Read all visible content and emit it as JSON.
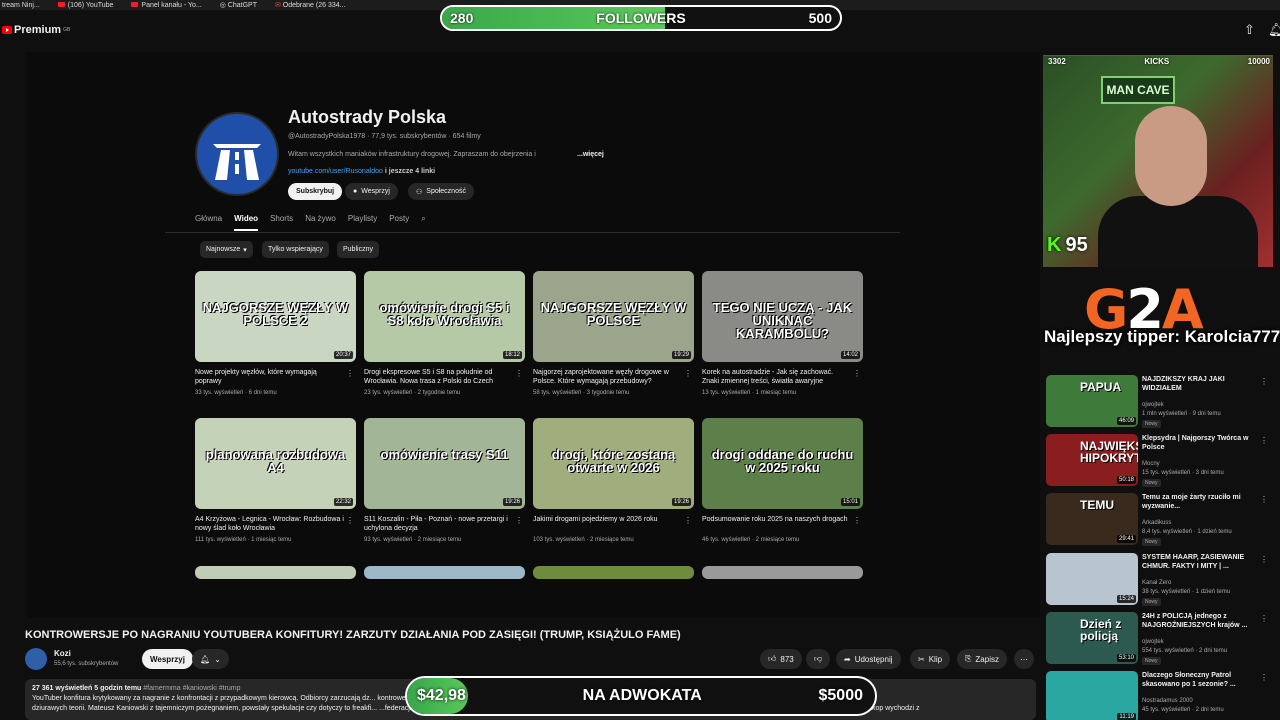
{
  "bookmarks": [
    "tream Ninj...",
    "(106) YouTube",
    "Panel kanału - Yo...",
    "ChatGPT",
    "Odebrane (26 334..."
  ],
  "header": {
    "logo_text": "Premium",
    "logo_sup": "GB"
  },
  "followers": {
    "current": "280",
    "label": "FOLLOWERS",
    "goal": "500",
    "progress": 0.56
  },
  "channel": {
    "name": "Autostrady Polska",
    "meta": "@AutostradyPolska1978 · 77,9 tys. subskrybentów · 654 filmy",
    "description": "Witam wszystkich maniaków infrastruktury drogowej. Zapraszam do obejrzenia i",
    "more": "...więcej",
    "link": "youtube.com/user/Rusonaldoo",
    "link_more": " i jeszcze 4 linki",
    "subscribe": "Subskrybuj",
    "support": "Wesprzyj",
    "community": "Społeczność",
    "tabs": [
      "Główna",
      "Wideo",
      "Shorts",
      "Na żywo",
      "Playlisty",
      "Posty"
    ],
    "chips": [
      "Najnowsze",
      "Tylko wspierający",
      "Publiczny"
    ]
  },
  "videos": [
    {
      "thumb_text": "NAJGORSZE WĘZŁY W POLSCE 2",
      "duration": "20:37",
      "title": "Nowe projekty węzłów, które wymagają poprawy",
      "meta": "33 tys. wyświetleń · 6 dni temu",
      "color": "#c9d6c2"
    },
    {
      "thumb_text": "omówienie drogi S5 i S8 koło Wrocławia",
      "duration": "18:12",
      "title": "Drogi ekspresowe S5 i S8 na południe od Wrocławia. Nowa trasa z Polski do Czech",
      "meta": "23 tys. wyświetleń · 2 tygodnie temu",
      "color": "#b6c9a6"
    },
    {
      "thumb_text": "NAJGORSZE WĘZŁY W POLSCE",
      "duration": "19:29",
      "title": "Najgorzej zaprojektowane węzły drogowe w Polsce. Które wymagają przebudowy?",
      "meta": "58 tys. wyświetleń · 3 tygodnie temu",
      "color": "#9aa58c"
    },
    {
      "thumb_text": "TEGO NIE UCZĄ - JAK UNIKNĄĆ KARAMBOLU?",
      "duration": "14:02",
      "title": "Korek na autostradzie - Jak się zachować. Znaki zmiennej treści, światła awaryjne",
      "meta": "13 tys. wyświetleń · 1 miesiąc temu",
      "color": "#8a8a86"
    },
    {
      "thumb_text": "planowana rozbudowa A4",
      "duration": "22:32",
      "title": "A4 Krzyżowa - Legnica - Wrocław: Rozbudowa i nowy ślad koło Wrocławia",
      "meta": "111 tys. wyświetleń · 1 miesiąc temu",
      "color": "#c4d2b8"
    },
    {
      "thumb_text": "omówienie trasy S11",
      "duration": "19:26",
      "title": "S11 Koszalin - Piła - Poznań - nowe przetargi i uchylona decyzja",
      "meta": "93 tys. wyświetleń · 2 miesiące temu",
      "color": "#a3b597"
    },
    {
      "thumb_text": "drogi, które zostaną otwarte w 2026",
      "duration": "19:26",
      "title": "Jakimi drogami pojedziemy w 2026 roku",
      "meta": "103 tys. wyświetleń · 2 miesiące temu",
      "color": "#9fae7c"
    },
    {
      "thumb_text": "drogi oddane do ruchu w 2025 roku",
      "duration": "15:01",
      "title": "Podsumowanie roku 2025 na naszych drogach",
      "meta": "46 tys. wyświetleń · 2 miesiące temu",
      "color": "#5d7f4a"
    }
  ],
  "player": {
    "title": "KONTROWERSJE PO NAGRANIU YOUTUBERA KONFITURY! ZARZUTY DZIAŁANIA POD ZASIĘGI! (TRUMP, KSIĄŻULO FAME)",
    "uploader": "Kozi",
    "uploader_subs": "55,6 tys. subskrybentów",
    "support": "Wesprzyj",
    "likes": "873",
    "share": "Udostępnij",
    "clip": "Klip",
    "save": "Zapisz",
    "desc_stats": "27 361 wyświetleń  5 godzin temu",
    "desc_tags": "#famermma #kaniowski #trump",
    "desc_line1": "YouTuber konfitura krytykowany za nagranie z konfrontacji z przypadkowym kierowcą. Odbiorcy zarzucają dz... kontrowersje oraz brak winy kie... ...cja FAME informuje o sprzedaży PPV... ...powiada ruchy medialne w kontrze do",
    "desc_line2": "dziurawych teorii. Mateusz Kaniowski z tajemniczym pożegnaniem, powstały spekulacje czy dotyczy to freakfi... ...federacji FAME i komentowania. 15 letni kolega Denisa miał na koszulce reklamę bukmachera, powstało pytanie czy może to wieść za sobą konsekwencje. Akop wychodzi z"
  },
  "donation": {
    "current": "$42,98",
    "label": "NA ADWOKATA",
    "goal": "$5000",
    "progress": 0.0086
  },
  "cam": {
    "left_count": "3302",
    "brand": "KICKS",
    "right_count": "10000",
    "sign": "MAN CAVE",
    "kick_viewers": "95"
  },
  "g2a": {
    "logo_a": "G",
    "logo_b": "2",
    "logo_c": "A",
    "tipper": "Najlepszy tipper: Karolcia777"
  },
  "recommended": [
    {
      "thumb_text": "PAPUA",
      "duration": "46:09",
      "title": "NAJDZIKSZY KRAJ JAKI WIDZIAŁEM",
      "channel": "ojwojtek",
      "meta": "1 mln wyświetleń · 9 dni temu",
      "badge": "Nowy",
      "color": "#3e7a3a"
    },
    {
      "thumb_text": "NAJWIĘKSZY HIPOKRYTA",
      "duration": "50:18",
      "title": "Klepsydra | Najgorszy Twórca w Polsce",
      "channel": "Mocny",
      "meta": "15 tys. wyświetleń · 3 dni temu",
      "badge": "Nowy",
      "color": "#8a1d1d"
    },
    {
      "thumb_text": "TEMU",
      "duration": "29:41",
      "title": "Temu za moje żarty rzuciło mi wyzwanie...",
      "channel": "Arkadikuss",
      "meta": "8,4 tys. wyświetleń · 1 dzień temu",
      "badge": "Nowy",
      "color": "#3a2a1e"
    },
    {
      "thumb_text": "",
      "duration": "15:24",
      "title": "SYSTEM HAARP, ZASIEWANIE CHMUR. FAKTY I MITY | ...",
      "channel": "Kanał Zero",
      "meta": "38 tys. wyświetleń · 1 dzień temu",
      "badge": "Nowy",
      "color": "#b8c4cf"
    },
    {
      "thumb_text": "Dzień z policją",
      "duration": "53:10",
      "title": "24H z POLICJĄ jednego z NAJGROŹNIEJSZYCH krajów ...",
      "channel": "ojwojtek",
      "meta": "554 tys. wyświetleń · 2 dni temu",
      "badge": "Nowy",
      "color": "#2d5a4f"
    },
    {
      "thumb_text": "",
      "duration": "11:19",
      "title": "Dlaczego Słoneczny Patrol skasowano po 1 sezonie? ...",
      "channel": "Nostradamus 2000",
      "meta": "45 tys. wyświetleń · 2 dni temu",
      "badge": "",
      "color": "#2aa7a0"
    }
  ]
}
